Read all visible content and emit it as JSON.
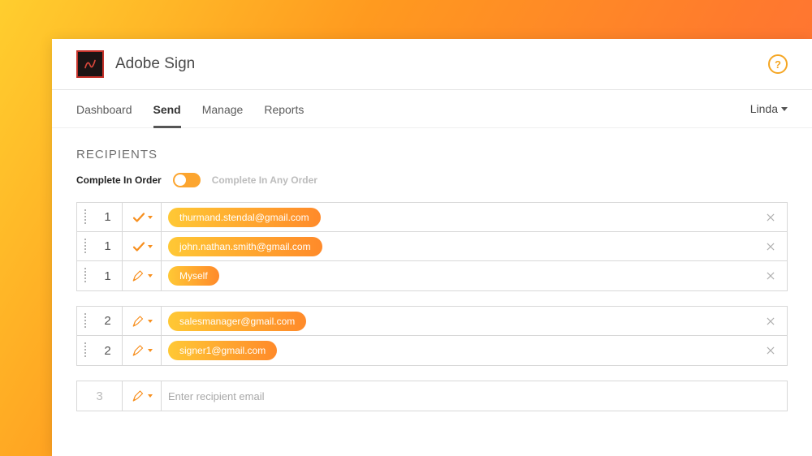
{
  "app": {
    "title": "Adobe Sign"
  },
  "tabs": [
    "Dashboard",
    "Send",
    "Manage",
    "Reports"
  ],
  "active_tab": "Send",
  "user": {
    "name": "Linda"
  },
  "section": {
    "title": "RECIPIENTS"
  },
  "order": {
    "label_on": "Complete In Order",
    "label_off": "Complete In Any Order"
  },
  "groups": [
    {
      "rows": [
        {
          "num": "1",
          "role": "approver",
          "email": "thurmand.stendal@gmail.com"
        },
        {
          "num": "1",
          "role": "approver",
          "email": "john.nathan.smith@gmail.com"
        },
        {
          "num": "1",
          "role": "signer",
          "email": "Myself"
        }
      ]
    },
    {
      "rows": [
        {
          "num": "2",
          "role": "signer",
          "email": "salesmanager@gmail.com"
        },
        {
          "num": "2",
          "role": "signer",
          "email": "signer1@gmail.com"
        }
      ]
    }
  ],
  "new_row": {
    "num": "3",
    "role": "signer",
    "placeholder": "Enter recipient email"
  }
}
